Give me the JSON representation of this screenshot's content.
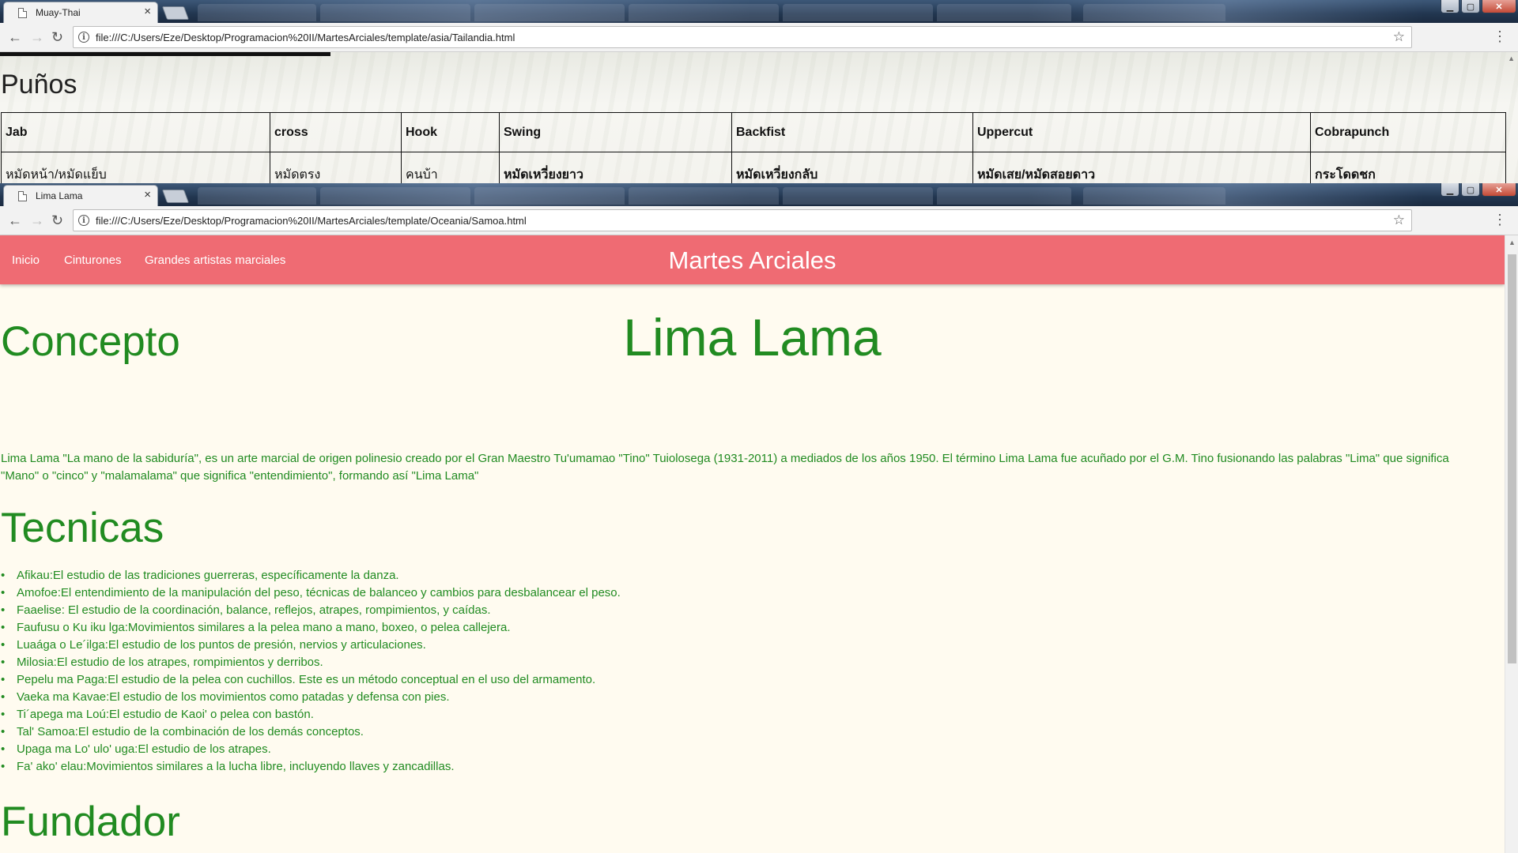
{
  "window_back": {
    "tab_title": "Muay-Thai",
    "url": "file:///C:/Users/Eze/Desktop/Programacion%20II/MartesArciales/template/asia/Tailandia.html",
    "heading": "Puños",
    "table_headers": [
      "Jab",
      "cross",
      "Hook",
      "Swing",
      "Backfist",
      "Uppercut",
      "Cobrapunch"
    ],
    "table_row": [
      "หมัดหน้า/หมัดแย็บ",
      "หมัดตรง",
      "คนบ้า",
      "หมัดเหวี่ยงยาว",
      "หมัดเหวี่ยงกลับ",
      "หมัดเสย/หมัดสอยดาว",
      "กระโดดชก"
    ]
  },
  "window_front": {
    "tab_title": "Lima Lama",
    "url": "file:///C:/Users/Eze/Desktop/Programacion%20II/MartesArciales/template/Oceania/Samoa.html",
    "navbar": {
      "links": [
        "Inicio",
        "Cinturones",
        "Grandes artistas marciales"
      ],
      "brand": "Martes Arciales"
    },
    "page_title": "Lima Lama",
    "concepto": {
      "title": "Concepto",
      "text": "Lima Lama \"La mano de la sabiduría\", es un arte marcial de origen polinesio creado por el Gran Maestro Tu'umamao \"Tino\" Tuiolosega (1931-2011) a mediados de los años 1950. El término Lima Lama fue acuñado por el G.M. Tino fusionando las palabras \"Lima\" que significa \"Mano\" o \"cinco\" y \"malamalama\" que significa \"entendimiento\", formando así \"Lima Lama\""
    },
    "tecnicas": {
      "title": "Tecnicas",
      "items": [
        "Afikau:El estudio de las tradiciones guerreras, específicamente la danza.",
        "Amofoe:El entendimiento de la manipulación del peso, técnicas de balanceo y cambios para desbalancear el peso.",
        "Faaelise: El estudio de la coordinación, balance, reflejos, atrapes, rompimientos, y caídas.",
        "Faufusu o Ku iku lga:Movimientos similares a la pelea mano a mano, boxeo, o pelea callejera.",
        "Luaága o Le´ilga:El estudio de los puntos de presión, nervios y articulaciones.",
        "Milosia:El estudio de los atrapes, rompimientos y derribos.",
        "Pepelu ma Paga:El estudio de la pelea con cuchillos. Este es un método conceptual en el uso del armamento.",
        "Vaeka ma Kavae:El estudio de los movimientos como patadas y defensa con pies.",
        "Ti´apega ma Loú:El estudio de Kaoi' o pelea con bastón.",
        "Tal' Samoa:El estudio de la combinación de los demás conceptos.",
        "Upaga ma Lo' ulo' uga:El estudio de los atrapes.",
        "Fa' ako' elau:Movimientos similares a la lucha libre, incluyendo llaves y zancadillas."
      ]
    },
    "fundador": {
      "title": "Fundador"
    }
  }
}
